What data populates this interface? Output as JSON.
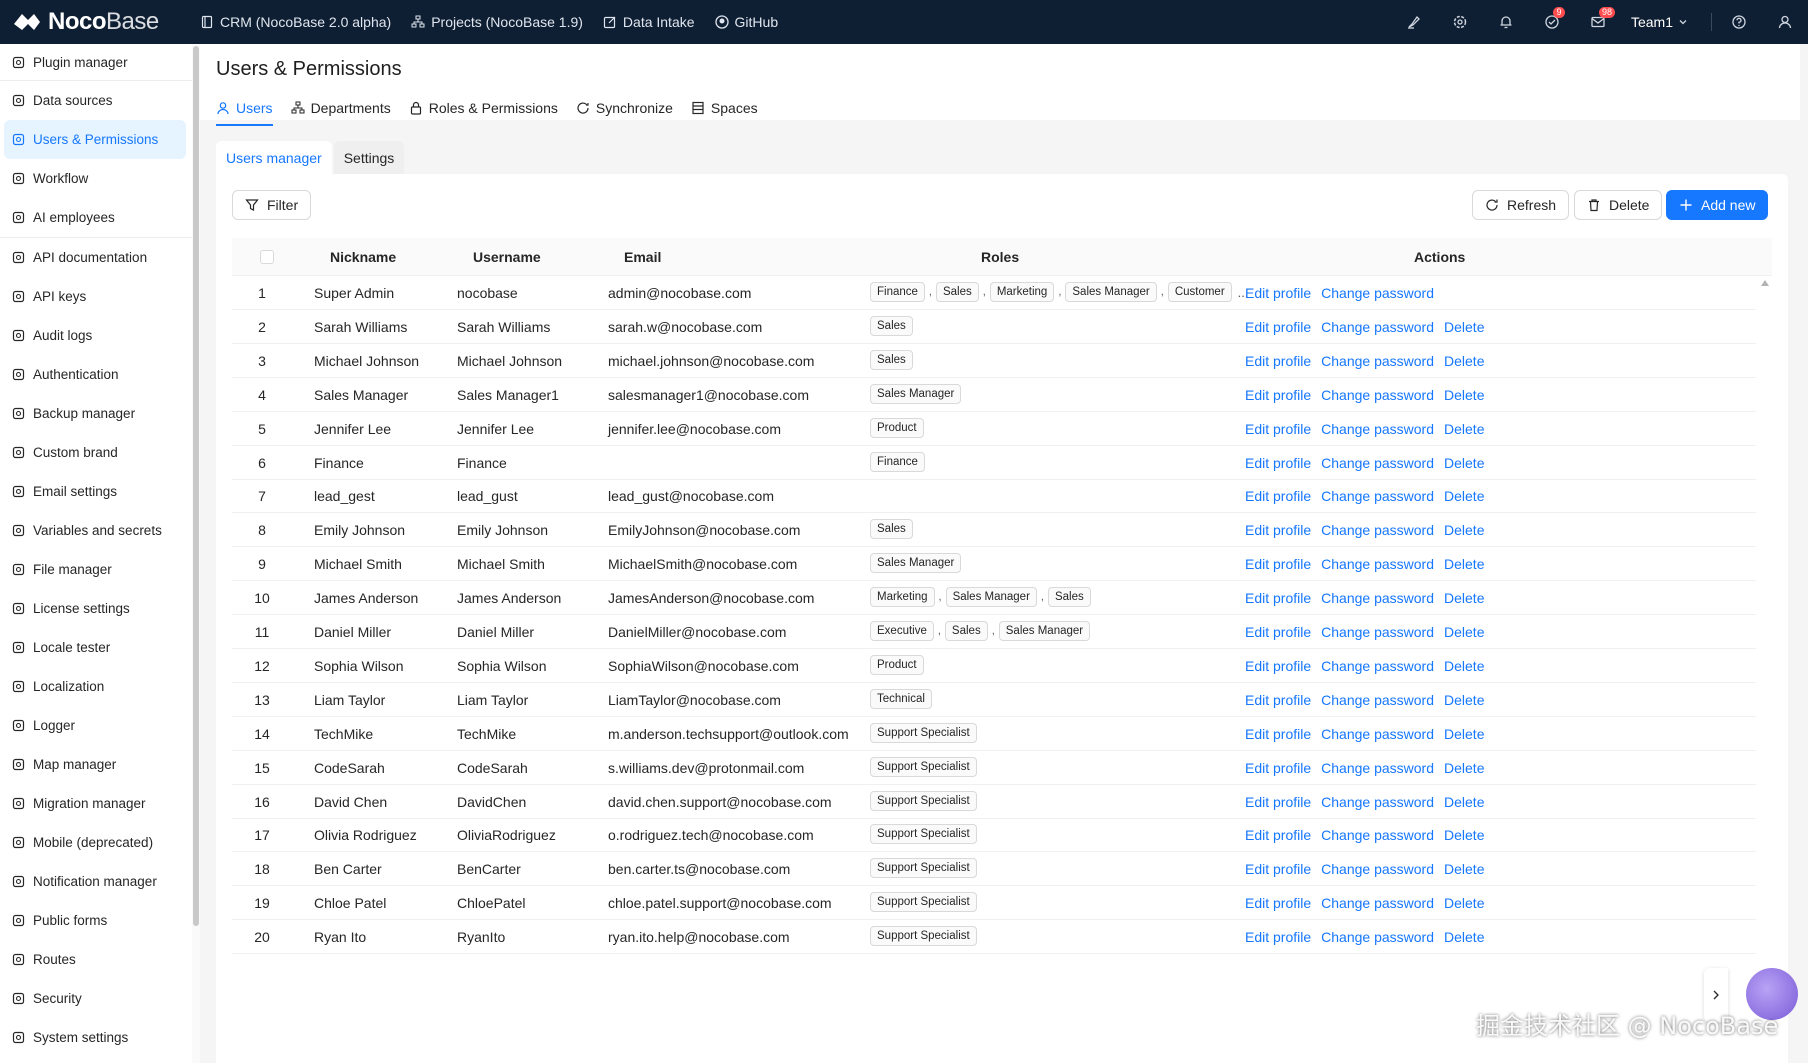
{
  "topbar": {
    "logo_main": "Noco",
    "logo_sub": "Base",
    "links": [
      {
        "label": "CRM (NocoBase 2.0 alpha)",
        "icon": "book-icon"
      },
      {
        "label": "Projects (NocoBase 1.9)",
        "icon": "org-icon"
      },
      {
        "label": "Data Intake",
        "icon": "edit-icon"
      },
      {
        "label": "GitHub",
        "icon": "github-icon"
      }
    ],
    "badge_tasks": "9",
    "badge_messages": "98",
    "team": "Team1"
  },
  "sidebar": {
    "items": [
      {
        "label": "Plugin manager"
      },
      {
        "label": "Data sources"
      },
      {
        "label": "Users & Permissions"
      },
      {
        "label": "Workflow"
      },
      {
        "label": "AI employees"
      },
      {
        "label": "API documentation"
      },
      {
        "label": "API keys"
      },
      {
        "label": "Audit logs"
      },
      {
        "label": "Authentication"
      },
      {
        "label": "Backup manager"
      },
      {
        "label": "Custom brand"
      },
      {
        "label": "Email settings"
      },
      {
        "label": "Variables and secrets"
      },
      {
        "label": "File manager"
      },
      {
        "label": "License settings"
      },
      {
        "label": "Locale tester"
      },
      {
        "label": "Localization"
      },
      {
        "label": "Logger"
      },
      {
        "label": "Map manager"
      },
      {
        "label": "Migration manager"
      },
      {
        "label": "Mobile (deprecated)"
      },
      {
        "label": "Notification manager"
      },
      {
        "label": "Public forms"
      },
      {
        "label": "Routes"
      },
      {
        "label": "Security"
      },
      {
        "label": "System settings"
      }
    ]
  },
  "page": {
    "title": "Users & Permissions",
    "tabs": [
      {
        "label": "Users"
      },
      {
        "label": "Departments"
      },
      {
        "label": "Roles & Permissions"
      },
      {
        "label": "Synchronize"
      },
      {
        "label": "Spaces"
      }
    ],
    "subtabs": [
      {
        "label": "Users manager"
      },
      {
        "label": "Settings"
      }
    ]
  },
  "toolbar": {
    "filter": "Filter",
    "refresh": "Refresh",
    "delete": "Delete",
    "add_new": "Add new"
  },
  "table": {
    "headers": {
      "nickname": "Nickname",
      "username": "Username",
      "email": "Email",
      "roles": "Roles",
      "actions": "Actions"
    },
    "action_labels": {
      "edit": "Edit profile",
      "change_password": "Change password",
      "delete": "Delete"
    },
    "more_roles": "...",
    "rows": [
      {
        "n": "1",
        "nickname": "Super Admin",
        "username": "nocobase",
        "email": "admin@nocobase.com",
        "roles": [
          "Finance",
          "Sales",
          "Marketing",
          "Sales Manager",
          "Customer"
        ],
        "more": true,
        "deletable": false
      },
      {
        "n": "2",
        "nickname": "Sarah Williams",
        "username": "Sarah Williams",
        "email": "sarah.w@nocobase.com",
        "roles": [
          "Sales"
        ],
        "deletable": true
      },
      {
        "n": "3",
        "nickname": "Michael Johnson",
        "username": "Michael Johnson",
        "email": "michael.johnson@nocobase.com",
        "roles": [
          "Sales"
        ],
        "deletable": true
      },
      {
        "n": "4",
        "nickname": "Sales Manager",
        "username": "Sales Manager1",
        "email": "salesmanager1@nocobase.com",
        "roles": [
          "Sales Manager"
        ],
        "deletable": true
      },
      {
        "n": "5",
        "nickname": "Jennifer Lee",
        "username": "Jennifer Lee",
        "email": "jennifer.lee@nocobase.com",
        "roles": [
          "Product"
        ],
        "deletable": true
      },
      {
        "n": "6",
        "nickname": "Finance",
        "username": "Finance",
        "email": "",
        "roles": [
          "Finance"
        ],
        "deletable": true
      },
      {
        "n": "7",
        "nickname": "lead_gest",
        "username": "lead_gust",
        "email": "lead_gust@nocobase.com",
        "roles": [],
        "deletable": true
      },
      {
        "n": "8",
        "nickname": "Emily Johnson",
        "username": "Emily Johnson",
        "email": "EmilyJohnson@nocobase.com",
        "roles": [
          "Sales"
        ],
        "deletable": true
      },
      {
        "n": "9",
        "nickname": "Michael Smith",
        "username": "Michael Smith",
        "email": "MichaelSmith@nocobase.com",
        "roles": [
          "Sales Manager"
        ],
        "deletable": true
      },
      {
        "n": "10",
        "nickname": "James Anderson",
        "username": "James Anderson",
        "email": "JamesAnderson@nocobase.com",
        "roles": [
          "Marketing",
          "Sales Manager",
          "Sales"
        ],
        "deletable": true
      },
      {
        "n": "11",
        "nickname": "Daniel Miller",
        "username": "Daniel Miller",
        "email": "DanielMiller@nocobase.com",
        "roles": [
          "Executive",
          "Sales",
          "Sales Manager"
        ],
        "deletable": true
      },
      {
        "n": "12",
        "nickname": "Sophia Wilson",
        "username": "Sophia Wilson",
        "email": "SophiaWilson@nocobase.com",
        "roles": [
          "Product"
        ],
        "deletable": true
      },
      {
        "n": "13",
        "nickname": "Liam Taylor",
        "username": "Liam Taylor",
        "email": "LiamTaylor@nocobase.com",
        "roles": [
          "Technical"
        ],
        "deletable": true
      },
      {
        "n": "14",
        "nickname": "TechMike",
        "username": "TechMike",
        "email": "m.anderson.techsupport@outlook.com",
        "roles": [
          "Support Specialist"
        ],
        "deletable": true
      },
      {
        "n": "15",
        "nickname": "CodeSarah",
        "username": "CodeSarah",
        "email": "s.williams.dev@protonmail.com",
        "roles": [
          "Support Specialist"
        ],
        "deletable": true
      },
      {
        "n": "16",
        "nickname": "David Chen",
        "username": "DavidChen",
        "email": "david.chen.support@nocobase.com",
        "roles": [
          "Support Specialist"
        ],
        "deletable": true
      },
      {
        "n": "17",
        "nickname": "Olivia Rodriguez",
        "username": "OliviaRodriguez",
        "email": "o.rodriguez.tech@nocobase.com",
        "roles": [
          "Support Specialist"
        ],
        "deletable": true
      },
      {
        "n": "18",
        "nickname": "Ben Carter",
        "username": "BenCarter",
        "email": "ben.carter.ts@nocobase.com",
        "roles": [
          "Support Specialist"
        ],
        "deletable": true
      },
      {
        "n": "19",
        "nickname": "Chloe Patel",
        "username": "ChloePatel",
        "email": "chloe.patel.support@nocobase.com",
        "roles": [
          "Support Specialist"
        ],
        "deletable": true
      },
      {
        "n": "20",
        "nickname": "Ryan Ito",
        "username": "RyanIto",
        "email": "ryan.ito.help@nocobase.com",
        "roles": [
          "Support Specialist"
        ],
        "deletable": true
      }
    ]
  },
  "watermark": "掘金技术社区 @ NocoBase",
  "colors": {
    "topbar": "#0f1f33",
    "accent": "#1677ff",
    "active_bg": "#e6f4ff"
  }
}
